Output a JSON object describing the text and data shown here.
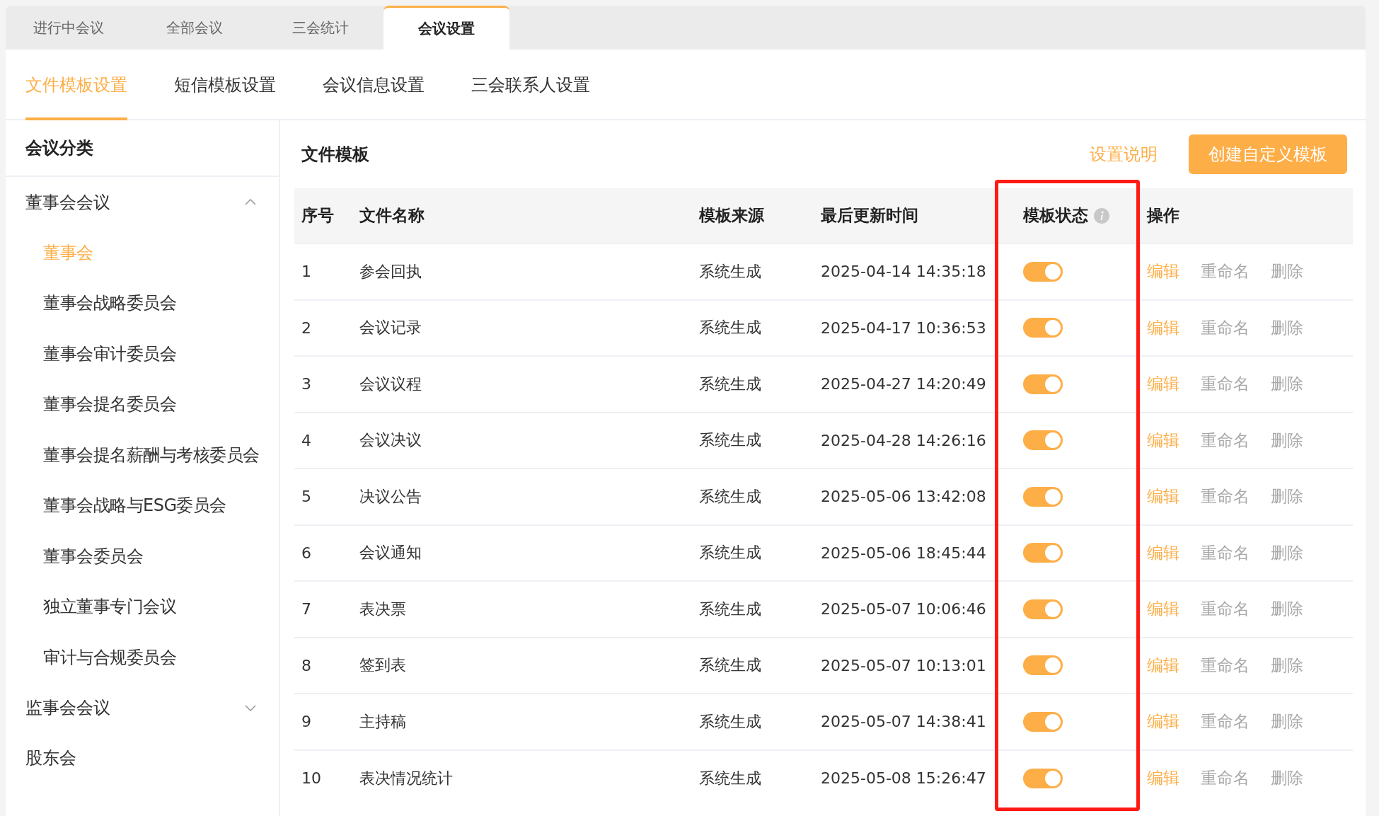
{
  "top_tabs": [
    {
      "label": "进行中会议",
      "selected": false
    },
    {
      "label": "全部会议",
      "selected": false
    },
    {
      "label": "三会统计",
      "selected": false
    },
    {
      "label": "会议设置",
      "selected": true
    }
  ],
  "sub_tabs": [
    {
      "label": "文件模板设置",
      "selected": true
    },
    {
      "label": "短信模板设置",
      "selected": false
    },
    {
      "label": "会议信息设置",
      "selected": false
    },
    {
      "label": "三会联系人设置",
      "selected": false
    }
  ],
  "sidebar": {
    "title": "会议分类",
    "items": [
      {
        "label": "董事会会议",
        "expanded": true,
        "children": [
          {
            "label": "董事会",
            "selected": true
          },
          {
            "label": "董事会战略委员会",
            "selected": false
          },
          {
            "label": "董事会审计委员会",
            "selected": false
          },
          {
            "label": "董事会提名委员会",
            "selected": false
          },
          {
            "label": "董事会提名薪酬与考核委员会",
            "selected": false
          },
          {
            "label": "董事会战略与ESG委员会",
            "selected": false
          },
          {
            "label": "董事会委员会",
            "selected": false
          },
          {
            "label": "独立董事专门会议",
            "selected": false
          },
          {
            "label": "审计与合规委员会",
            "selected": false
          }
        ]
      },
      {
        "label": "监事会会议",
        "expanded": false
      },
      {
        "label": "股东会",
        "selected": false
      }
    ]
  },
  "content": {
    "title": "文件模板",
    "help_link": "设置说明",
    "create_button": "创建自定义模板",
    "table": {
      "columns": [
        {
          "label": "序号"
        },
        {
          "label": "文件名称"
        },
        {
          "label": "模板来源"
        },
        {
          "label": "最后更新时间"
        },
        {
          "label": "模板状态",
          "highlighted": true,
          "info": true
        },
        {
          "label": "操作"
        }
      ],
      "rows": [
        {
          "index": "1",
          "name": "参会回执",
          "source": "系统生成",
          "updated": "2025-04-14 14:35:18",
          "on": true,
          "actions": [
            {
              "label": "编辑",
              "disabled": false
            },
            {
              "label": "重命名",
              "disabled": true
            },
            {
              "label": "删除",
              "disabled": true
            }
          ]
        },
        {
          "index": "2",
          "name": "会议记录",
          "source": "系统生成",
          "updated": "2025-04-17 10:36:53",
          "on": true,
          "actions": [
            {
              "label": "编辑",
              "disabled": false
            },
            {
              "label": "重命名",
              "disabled": true
            },
            {
              "label": "删除",
              "disabled": true
            }
          ]
        },
        {
          "index": "3",
          "name": "会议议程",
          "source": "系统生成",
          "updated": "2025-04-27 14:20:49",
          "on": true,
          "actions": [
            {
              "label": "编辑",
              "disabled": false
            },
            {
              "label": "重命名",
              "disabled": true
            },
            {
              "label": "删除",
              "disabled": true
            }
          ]
        },
        {
          "index": "4",
          "name": "会议决议",
          "source": "系统生成",
          "updated": "2025-04-28 14:26:16",
          "on": true,
          "actions": [
            {
              "label": "编辑",
              "disabled": false
            },
            {
              "label": "重命名",
              "disabled": true
            },
            {
              "label": "删除",
              "disabled": true
            }
          ]
        },
        {
          "index": "5",
          "name": "决议公告",
          "source": "系统生成",
          "updated": "2025-05-06 13:42:08",
          "on": true,
          "actions": [
            {
              "label": "编辑",
              "disabled": false
            },
            {
              "label": "重命名",
              "disabled": true
            },
            {
              "label": "删除",
              "disabled": true
            }
          ]
        },
        {
          "index": "6",
          "name": "会议通知",
          "source": "系统生成",
          "updated": "2025-05-06 18:45:44",
          "on": true,
          "actions": [
            {
              "label": "编辑",
              "disabled": false
            },
            {
              "label": "重命名",
              "disabled": true
            },
            {
              "label": "删除",
              "disabled": true
            }
          ]
        },
        {
          "index": "7",
          "name": "表决票",
          "source": "系统生成",
          "updated": "2025-05-07 10:06:46",
          "on": true,
          "actions": [
            {
              "label": "编辑",
              "disabled": false
            },
            {
              "label": "重命名",
              "disabled": true
            },
            {
              "label": "删除",
              "disabled": true
            }
          ]
        },
        {
          "index": "8",
          "name": "签到表",
          "source": "系统生成",
          "updated": "2025-05-07 10:13:01",
          "on": true,
          "actions": [
            {
              "label": "编辑",
              "disabled": false
            },
            {
              "label": "重命名",
              "disabled": true
            },
            {
              "label": "删除",
              "disabled": true
            }
          ]
        },
        {
          "index": "9",
          "name": "主持稿",
          "source": "系统生成",
          "updated": "2025-05-07 14:38:41",
          "on": true,
          "actions": [
            {
              "label": "编辑",
              "disabled": false
            },
            {
              "label": "重命名",
              "disabled": true
            },
            {
              "label": "删除",
              "disabled": true
            }
          ]
        },
        {
          "index": "10",
          "name": "表决情况统计",
          "source": "系统生成",
          "updated": "2025-05-08 15:26:47",
          "on": true,
          "actions": [
            {
              "label": "编辑",
              "disabled": false
            },
            {
              "label": "重命名",
              "disabled": true
            },
            {
              "label": "删除",
              "disabled": true
            }
          ]
        }
      ]
    }
  }
}
